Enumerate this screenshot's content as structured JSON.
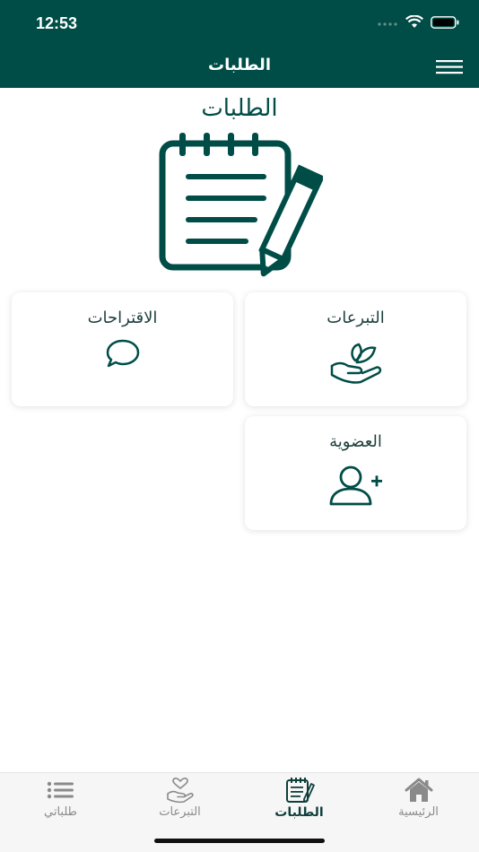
{
  "status_bar": {
    "time": "12:53"
  },
  "nav": {
    "title": "الطلبات",
    "menu_icon": "hamburger-menu-icon"
  },
  "page": {
    "heading": "الطلبات",
    "hero_icon": "notepad-pencil-icon"
  },
  "cards": [
    {
      "label": "التبرعات",
      "icon": "hand-leaf-icon"
    },
    {
      "label": "الاقتراحات",
      "icon": "speech-bubble-icon"
    },
    {
      "label": "العضوية",
      "icon": "add-user-icon"
    }
  ],
  "tabs": [
    {
      "label": "الرئيسية",
      "icon": "home-icon"
    },
    {
      "label": "الطلبات",
      "icon": "notepad-icon",
      "active": true
    },
    {
      "label": "التبرعات",
      "icon": "hand-heart-icon"
    },
    {
      "label": "طلباتي",
      "icon": "list-icon"
    }
  ],
  "colors": {
    "primary": "#004d47",
    "tab_inactive": "#8a8a8a",
    "tab_active": "#0f3f3b"
  }
}
